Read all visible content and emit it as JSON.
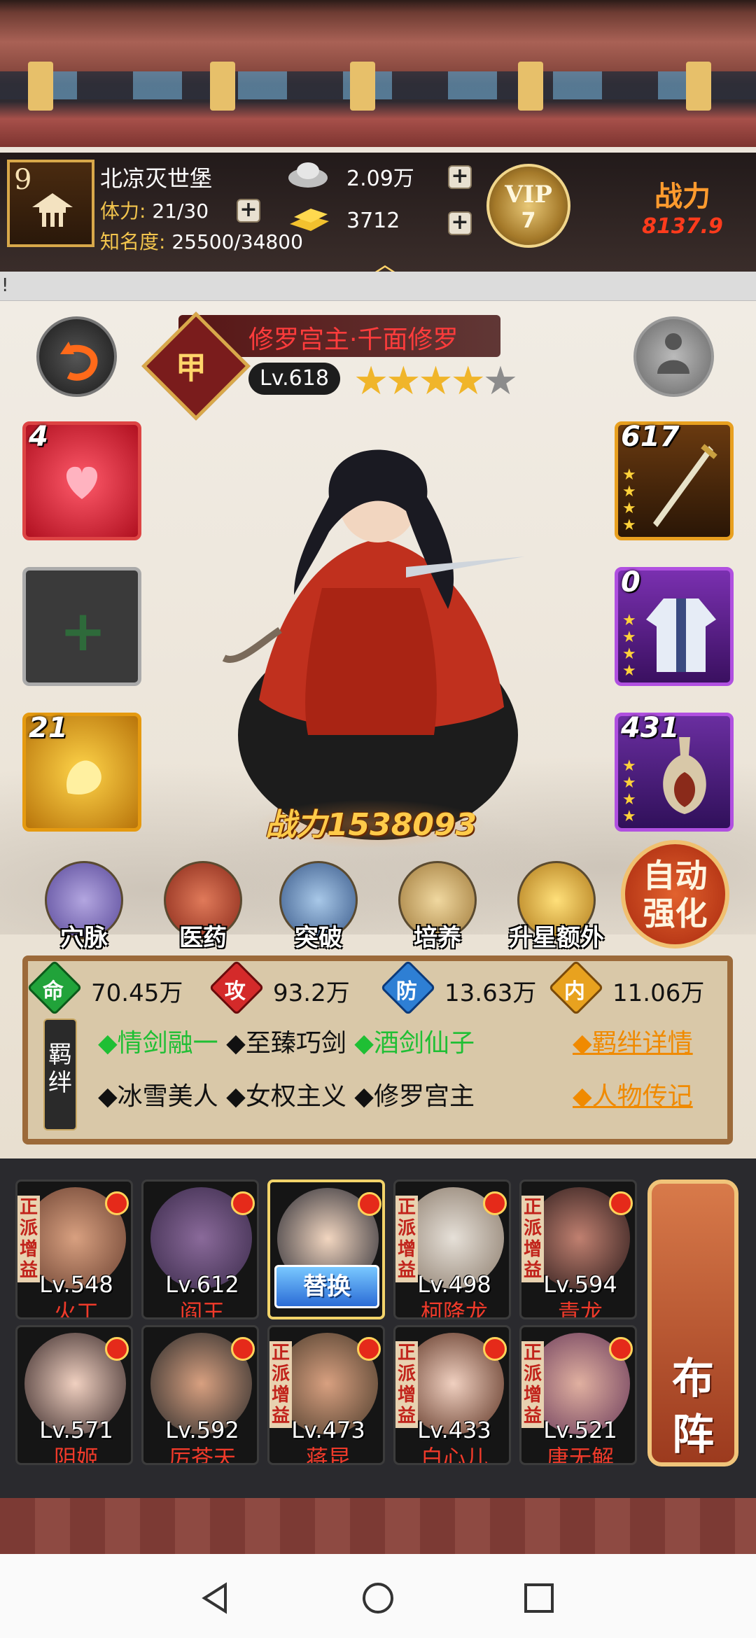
{
  "player": {
    "level": "9",
    "name": "北凉灭世堡",
    "stamina_label": "体力:",
    "stamina_value": "21/30",
    "fame_label": "知名度:",
    "fame_value": "25500/34800"
  },
  "currency": {
    "silver": "2.09万",
    "gold": "3712"
  },
  "vip": {
    "label": "VIP",
    "level": "7"
  },
  "power_header": {
    "label": "战力",
    "value": "8137.9"
  },
  "notice": "!",
  "hero": {
    "title": "修罗宫主·千面修罗",
    "rank_glyph": "甲",
    "level": "Lv.618",
    "stars_filled": 4,
    "stars_total": 5,
    "battle_power": "战力1538093"
  },
  "left_slots": [
    {
      "count": "4",
      "name": "heart-skill"
    },
    {
      "count": "",
      "name": "add-slot"
    },
    {
      "count": "21",
      "name": "fragment-skill"
    }
  ],
  "right_slots": [
    {
      "count": "617",
      "name": "sword-equipment"
    },
    {
      "count": "0",
      "name": "armor-equipment"
    },
    {
      "count": "431",
      "name": "vase-equipment"
    }
  ],
  "actions": [
    {
      "label": "穴脉"
    },
    {
      "label": "医药"
    },
    {
      "label": "突破"
    },
    {
      "label": "培养"
    },
    {
      "label": "升星额外"
    }
  ],
  "auto_enhance": {
    "line1": "自动",
    "line2": "强化"
  },
  "attributes": [
    {
      "glyph": "命",
      "value": "70.45万",
      "color": "#21a33a"
    },
    {
      "glyph": "攻",
      "value": "93.2万",
      "color": "#d42a2a"
    },
    {
      "glyph": "防",
      "value": "13.63万",
      "color": "#2e7fd4"
    },
    {
      "glyph": "内",
      "value": "11.06万",
      "color": "#e8a21f"
    }
  ],
  "bonds": {
    "tag": "羁绊",
    "row1": [
      "◆情剑融一",
      "◆至臻巧剑",
      "◆酒剑仙子"
    ],
    "row2": [
      "◆冰雪美人",
      "◆女权主义",
      "◆修罗宫主"
    ],
    "link_detail": "◆羁绊详情",
    "link_story": "◆人物传记"
  },
  "lineup": [
    {
      "lv": "Lv.548",
      "name": "火工",
      "tag": "正派增益"
    },
    {
      "lv": "Lv.612",
      "name": "阎王",
      "tag": ""
    },
    {
      "lv": "",
      "name": "",
      "tag": "",
      "swap": "替换"
    },
    {
      "lv": "Lv.498",
      "name": "柯降龙",
      "tag": "正派增益"
    },
    {
      "lv": "Lv.594",
      "name": "青龙",
      "tag": "正派增益"
    },
    {
      "lv": "Lv.571",
      "name": "阴姬",
      "tag": ""
    },
    {
      "lv": "Lv.592",
      "name": "厉苍天",
      "tag": ""
    },
    {
      "lv": "Lv.473",
      "name": "蒋昆",
      "tag": "正派增益"
    },
    {
      "lv": "Lv.433",
      "name": "白心儿",
      "tag": "正派增益"
    },
    {
      "lv": "Lv.521",
      "name": "唐无解",
      "tag": "正派增益"
    }
  ],
  "formation": {
    "line1": "布",
    "line2": "阵"
  }
}
